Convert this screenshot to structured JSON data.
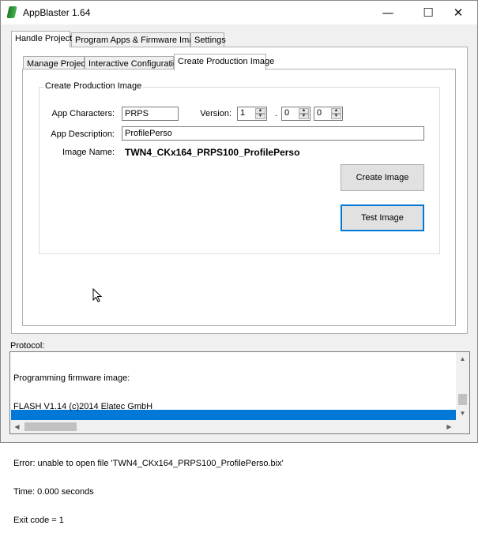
{
  "window": {
    "title": "AppBlaster 1.64"
  },
  "titlebar_buttons": {
    "minimize": "—",
    "maximize": "☐",
    "close": "✕"
  },
  "main_tabs": [
    {
      "label": "Handle Project",
      "active": true
    },
    {
      "label": "Program Apps & Firmware Images",
      "active": false
    },
    {
      "label": "Settings",
      "active": false
    }
  ],
  "sub_tabs": [
    {
      "label": "Manage Project",
      "active": false
    },
    {
      "label": "Interactive Configuration",
      "active": false
    },
    {
      "label": "Create Production Image",
      "active": true
    }
  ],
  "group": {
    "title": "Create Production Image",
    "app_characters_label": "App Characters:",
    "app_characters_value": "PRPS",
    "version_label": "Version:",
    "version_major": "1",
    "version_minor": "0",
    "version_patch": "0",
    "version_sep": ".",
    "app_description_label": "App Description:",
    "app_description_value": "ProfilePerso",
    "image_name_label": "Image Name:",
    "image_name_value": "TWN4_CKx164_PRPS100_ProfilePerso",
    "create_button": "Create Image",
    "test_button": "Test Image"
  },
  "protocol": {
    "label": "Protocol:",
    "lines": [
      "Programming firmware image:",
      "FLASH V1.14 (c)2014 Elatec GmbH",
      "",
      "Error: unable to open file 'TWN4_CKx164_PRPS100_ProfilePerso.bix'",
      "Time: 0.000 seconds",
      "Exit code = 1"
    ]
  },
  "scrollbar_glyphs": {
    "up": "▲",
    "down": "▼",
    "left": "◀",
    "right": "▶"
  },
  "colors": {
    "accent": "#0078d7",
    "window_bg": "#f0f0f0"
  }
}
